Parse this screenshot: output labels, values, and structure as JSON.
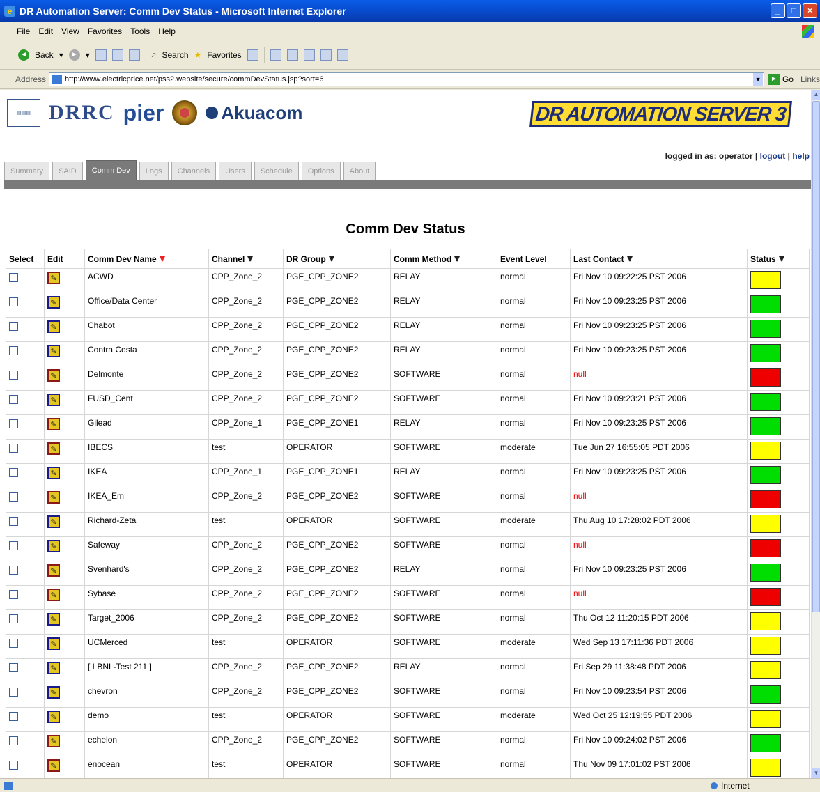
{
  "window": {
    "title": "DR Automation Server: Comm Dev Status - Microsoft Internet Explorer"
  },
  "menu": [
    "File",
    "Edit",
    "View",
    "Favorites",
    "Tools",
    "Help"
  ],
  "toolbar": {
    "back": "Back",
    "search": "Search",
    "favorites": "Favorites"
  },
  "address": {
    "label": "Address",
    "url": "http://www.electricprice.net/pss2.website/secure/commDevStatus.jsp?sort=6",
    "go": "Go",
    "links": "Links"
  },
  "header": {
    "drrc": "DRRC",
    "pier": "pier",
    "akuacom": "Akuacom",
    "server": "DR AUTOMATION SERVER 3",
    "login": {
      "prefix": "logged in as: operator |",
      "logout": "logout",
      "sep": "|",
      "help": "help"
    }
  },
  "tabs": [
    "Summary",
    "SAID",
    "Comm Dev",
    "Logs",
    "Channels",
    "Users",
    "Schedule",
    "Options",
    "About"
  ],
  "active_tab": "Comm Dev",
  "page_title": "Comm Dev Status",
  "columns": [
    "Select",
    "Edit",
    "Comm Dev Name",
    "Channel",
    "DR Group",
    "Comm Method",
    "Event Level",
    "Last Contact",
    "Status"
  ],
  "rows": [
    {
      "name": "ACWD",
      "channel": "CPP_Zone_2",
      "group": "PGE_CPP_ZONE2",
      "method": "RELAY",
      "level": "normal",
      "contact": "Fri Nov 10 09:22:25 PST 2006",
      "status": "#ffff00",
      "editRed": true
    },
    {
      "name": "Office/Data Center",
      "channel": "CPP_Zone_2",
      "group": "PGE_CPP_ZONE2",
      "method": "RELAY",
      "level": "normal",
      "contact": "Fri Nov 10 09:23:25 PST 2006",
      "status": "#00dd00",
      "editRed": false
    },
    {
      "name": "Chabot",
      "channel": "CPP_Zone_2",
      "group": "PGE_CPP_ZONE2",
      "method": "RELAY",
      "level": "normal",
      "contact": "Fri Nov 10 09:23:25 PST 2006",
      "status": "#00dd00",
      "editRed": false
    },
    {
      "name": "Contra Costa",
      "channel": "CPP_Zone_2",
      "group": "PGE_CPP_ZONE2",
      "method": "RELAY",
      "level": "normal",
      "contact": "Fri Nov 10 09:23:25 PST 2006",
      "status": "#00dd00",
      "editRed": false
    },
    {
      "name": "Delmonte",
      "channel": "CPP_Zone_2",
      "group": "PGE_CPP_ZONE2",
      "method": "SOFTWARE",
      "level": "normal",
      "contact": "null",
      "status": "#ee0000",
      "editRed": true
    },
    {
      "name": "FUSD_Cent",
      "channel": "CPP_Zone_2",
      "group": "PGE_CPP_ZONE2",
      "method": "SOFTWARE",
      "level": "normal",
      "contact": "Fri Nov 10 09:23:21 PST 2006",
      "status": "#00dd00",
      "editRed": false
    },
    {
      "name": "Gilead",
      "channel": "CPP_Zone_1",
      "group": "PGE_CPP_ZONE1",
      "method": "RELAY",
      "level": "normal",
      "contact": "Fri Nov 10 09:23:25 PST 2006",
      "status": "#00dd00",
      "editRed": true
    },
    {
      "name": "IBECS",
      "channel": "test",
      "group": "OPERATOR",
      "method": "SOFTWARE",
      "level": "moderate",
      "contact": "Tue Jun 27 16:55:05 PDT 2006",
      "status": "#ffff00",
      "editRed": true
    },
    {
      "name": "IKEA",
      "channel": "CPP_Zone_1",
      "group": "PGE_CPP_ZONE1",
      "method": "RELAY",
      "level": "normal",
      "contact": "Fri Nov 10 09:23:25 PST 2006",
      "status": "#00dd00",
      "editRed": false
    },
    {
      "name": "IKEA_Em",
      "channel": "CPP_Zone_2",
      "group": "PGE_CPP_ZONE2",
      "method": "SOFTWARE",
      "level": "normal",
      "contact": "null",
      "status": "#ee0000",
      "editRed": true
    },
    {
      "name": "Richard-Zeta",
      "channel": "test",
      "group": "OPERATOR",
      "method": "SOFTWARE",
      "level": "moderate",
      "contact": "Thu Aug 10 17:28:02 PDT 2006",
      "status": "#ffff00",
      "editRed": false
    },
    {
      "name": "Safeway",
      "channel": "CPP_Zone_2",
      "group": "PGE_CPP_ZONE2",
      "method": "SOFTWARE",
      "level": "normal",
      "contact": "null",
      "status": "#ee0000",
      "editRed": false
    },
    {
      "name": "Svenhard's",
      "channel": "CPP_Zone_2",
      "group": "PGE_CPP_ZONE2",
      "method": "RELAY",
      "level": "normal",
      "contact": "Fri Nov 10 09:23:25 PST 2006",
      "status": "#00dd00",
      "editRed": true
    },
    {
      "name": "Sybase",
      "channel": "CPP_Zone_2",
      "group": "PGE_CPP_ZONE2",
      "method": "SOFTWARE",
      "level": "normal",
      "contact": "null",
      "status": "#ee0000",
      "editRed": true
    },
    {
      "name": "Target_2006",
      "channel": "CPP_Zone_2",
      "group": "PGE_CPP_ZONE2",
      "method": "SOFTWARE",
      "level": "normal",
      "contact": "Thu Oct 12 11:20:15 PDT 2006",
      "status": "#ffff00",
      "editRed": false
    },
    {
      "name": "UCMerced",
      "channel": "test",
      "group": "OPERATOR",
      "method": "SOFTWARE",
      "level": "moderate",
      "contact": "Wed Sep 13 17:11:36 PDT 2006",
      "status": "#ffff00",
      "editRed": false
    },
    {
      "name": "[ LBNL-Test 211 ]",
      "channel": "CPP_Zone_2",
      "group": "PGE_CPP_ZONE2",
      "method": "RELAY",
      "level": "normal",
      "contact": "Fri Sep 29 11:38:48 PDT 2006",
      "status": "#ffff00",
      "editRed": false
    },
    {
      "name": "chevron",
      "channel": "CPP_Zone_2",
      "group": "PGE_CPP_ZONE2",
      "method": "SOFTWARE",
      "level": "normal",
      "contact": "Fri Nov 10 09:23:54 PST 2006",
      "status": "#00dd00",
      "editRed": false
    },
    {
      "name": "demo",
      "channel": "test",
      "group": "OPERATOR",
      "method": "SOFTWARE",
      "level": "moderate",
      "contact": "Wed Oct 25 12:19:55 PDT 2006",
      "status": "#ffff00",
      "editRed": false
    },
    {
      "name": "echelon",
      "channel": "CPP_Zone_2",
      "group": "PGE_CPP_ZONE2",
      "method": "SOFTWARE",
      "level": "normal",
      "contact": "Fri Nov 10 09:24:02 PST 2006",
      "status": "#00dd00",
      "editRed": true
    },
    {
      "name": "enocean",
      "channel": "test",
      "group": "OPERATOR",
      "method": "SOFTWARE",
      "level": "normal",
      "contact": "Thu Nov 09 17:01:02 PST 2006",
      "status": "#ffff00",
      "editRed": true
    }
  ],
  "statusbar": {
    "zone": "Internet"
  }
}
